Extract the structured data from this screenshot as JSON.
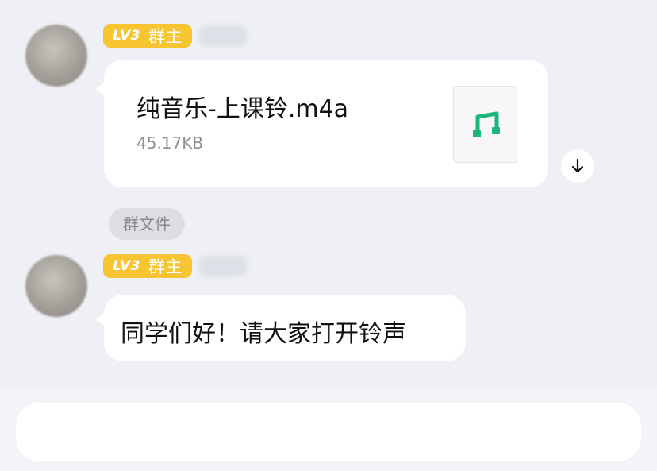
{
  "messages": [
    {
      "sender": {
        "level": "LV3",
        "role": "群主"
      },
      "file": {
        "name": "纯音乐-上课铃.m4a",
        "size": "45.17KB",
        "icon": "music-note-icon"
      },
      "download_icon": "download-arrow-icon"
    },
    {
      "sender": {
        "level": "LV3",
        "role": "群主"
      },
      "text": "同学们好！请大家打开铃声"
    }
  ],
  "group_file_tag": "群文件",
  "colors": {
    "background": "#eef0f5",
    "badge": "#f7c531",
    "music_icon": "#1bb67a",
    "bubble": "#ffffff"
  }
}
